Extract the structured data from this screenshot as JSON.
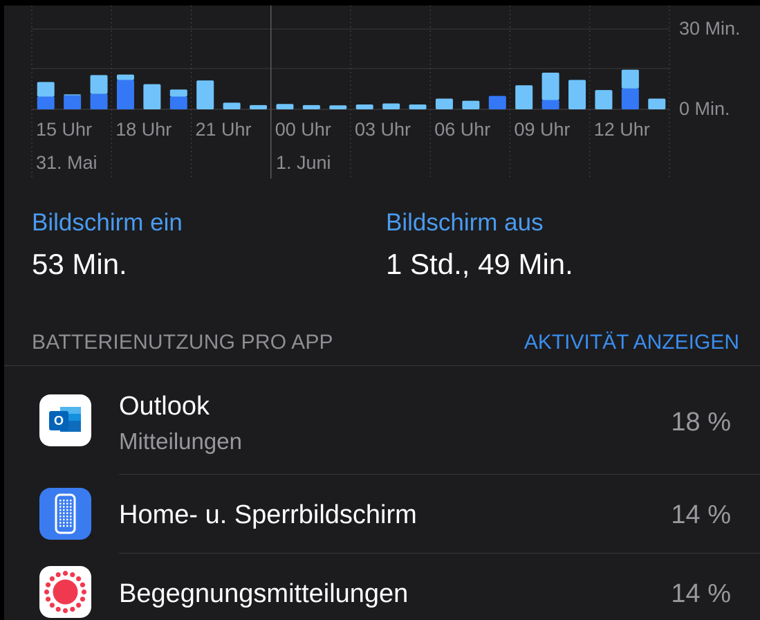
{
  "chart_data": {
    "type": "bar",
    "stacked": true,
    "y_axis_labels": [
      "30 Min.",
      "0 Min."
    ],
    "ylim": [
      0,
      30
    ],
    "x_tick_labels": [
      "15 Uhr",
      "18 Uhr",
      "21 Uhr",
      "00 Uhr",
      "03 Uhr",
      "06 Uhr",
      "09 Uhr",
      "12 Uhr"
    ],
    "date_labels": [
      "31. Mai",
      "1. Juni"
    ],
    "series": [
      {
        "color": "#3478f6",
        "values": [
          4.8,
          5.2,
          5.8,
          11.0,
          0.0,
          4.8,
          0.0,
          0.0,
          0.0,
          0.0,
          0.0,
          0.0,
          0.0,
          0.0,
          0.0,
          0.0,
          0.0,
          5.0,
          0.0,
          3.5,
          0.0,
          0.0,
          7.8,
          0.0
        ]
      },
      {
        "color": "#6fc3fa",
        "values": [
          5.4,
          0.4,
          7.0,
          2.0,
          9.4,
          2.6,
          10.8,
          2.5,
          1.6,
          2.0,
          1.6,
          1.5,
          1.8,
          2.2,
          1.8,
          4.0,
          3.2,
          0.0,
          9.0,
          10.2,
          11.0,
          7.2,
          7.0,
          4.0
        ]
      }
    ]
  },
  "stats": {
    "screen_on_label": "Bildschirm ein",
    "screen_on_value": "53 Min.",
    "screen_off_label": "Bildschirm aus",
    "screen_off_value": "1 Std., 49 Min."
  },
  "section": {
    "title": "BATTERIENUTZUNG PRO APP",
    "action": "AKTIVITÄT ANZEIGEN"
  },
  "apps": [
    {
      "name": "Outlook",
      "subtitle": "Mitteilungen",
      "percent": "18 %",
      "icon": "outlook-icon"
    },
    {
      "name": "Home- u. Sperrbildschirm",
      "subtitle": "",
      "percent": "14 %",
      "icon": "phone-screen-icon"
    },
    {
      "name": "Begegnungsmitteilungen",
      "subtitle": "",
      "percent": "14 %",
      "icon": "exposure-notification-icon"
    }
  ],
  "colors": {
    "accent": "#4a9bf0",
    "background": "#1c1c1e",
    "bar_dark": "#3478f6",
    "bar_light": "#6fc3fa"
  }
}
